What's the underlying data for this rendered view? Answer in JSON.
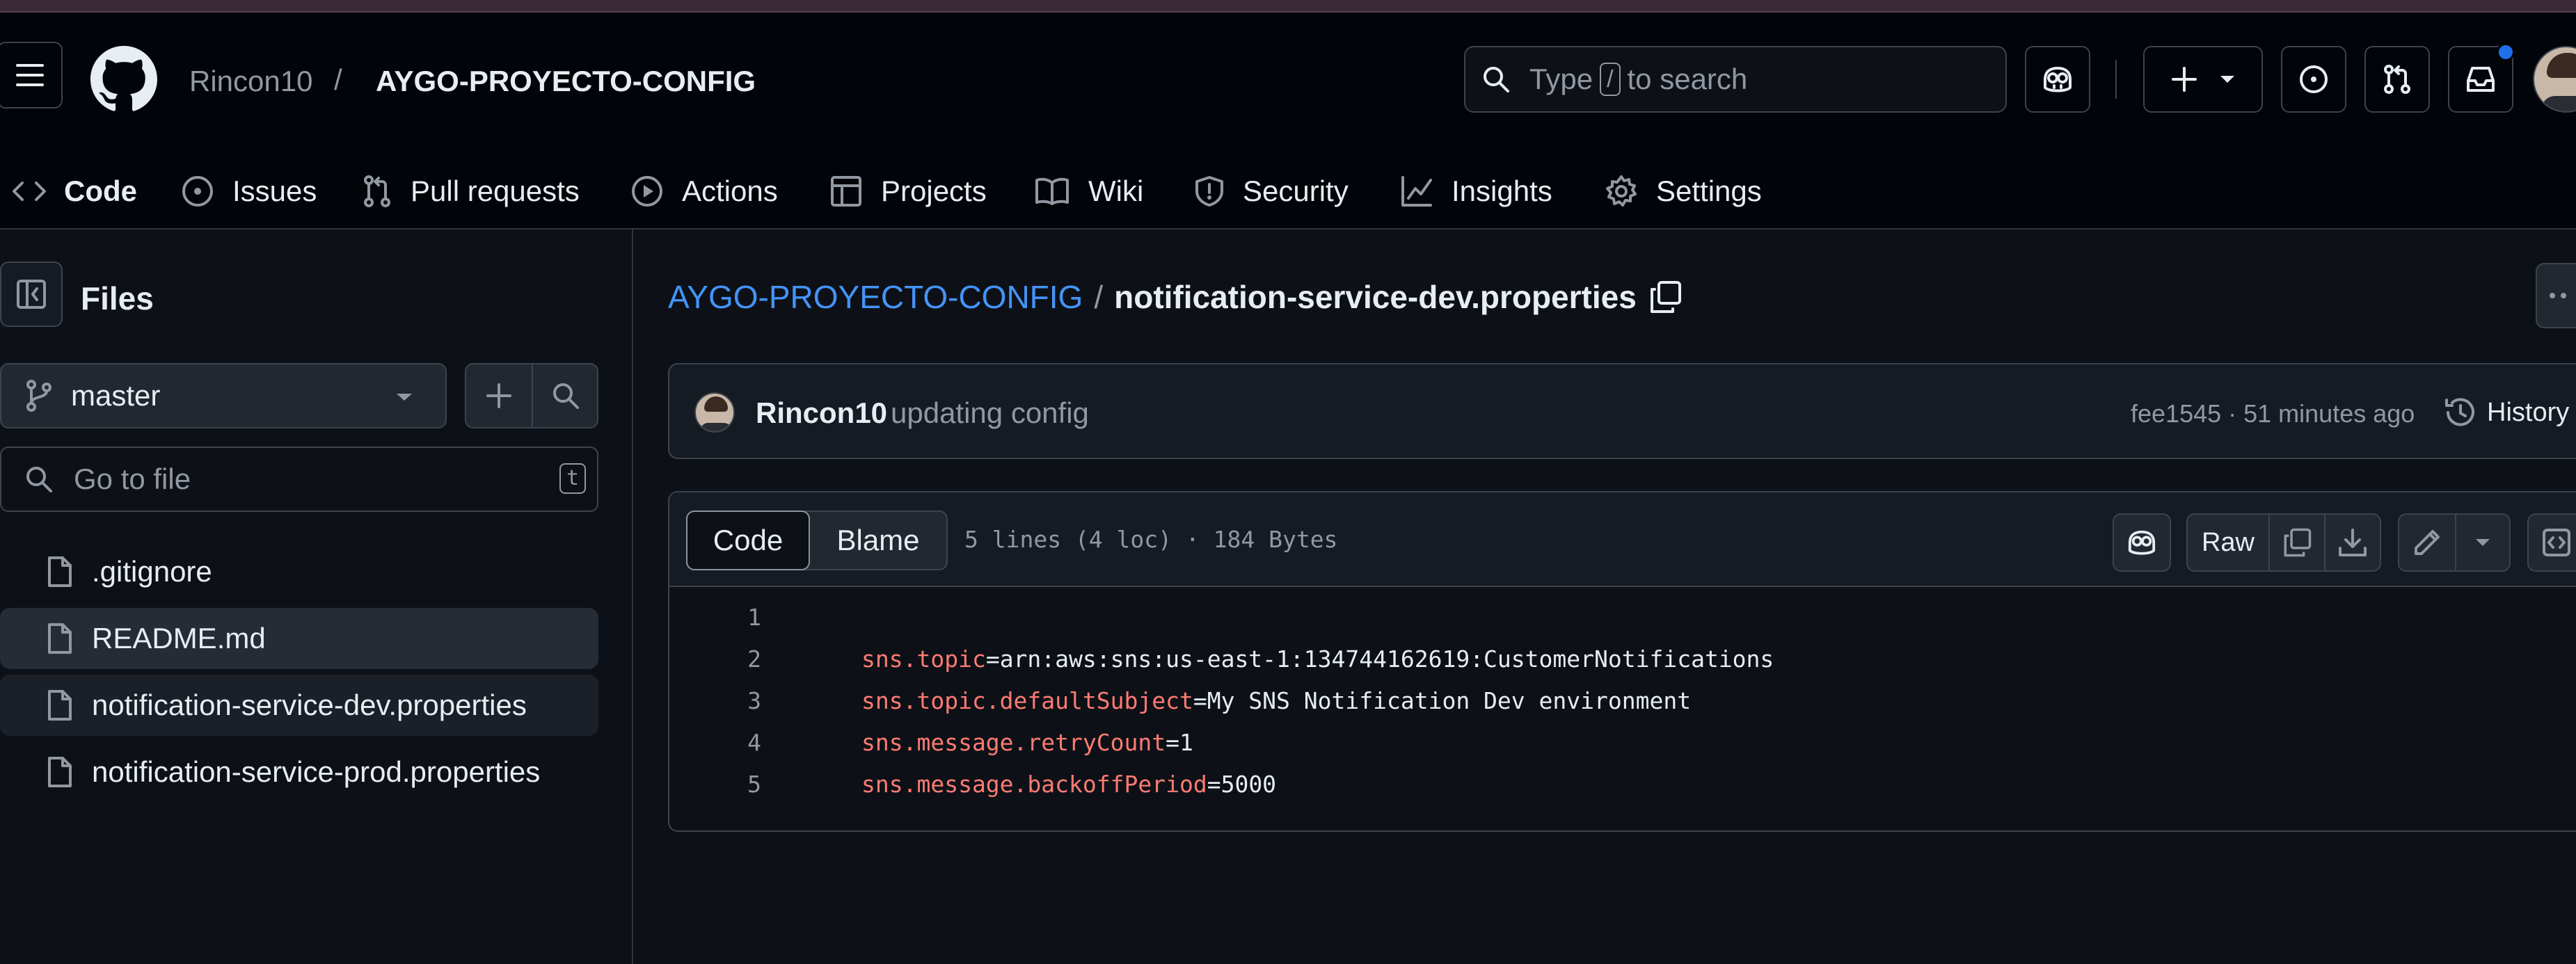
{
  "header": {
    "owner": "Rincon10",
    "separator": "/",
    "repo": "AYGO-PROYECTO-CONFIG",
    "search": {
      "prefix": "Type",
      "key": "/",
      "suffix": "to search"
    }
  },
  "tabs": [
    {
      "label": "Code",
      "icon": "code-icon",
      "selected": true
    },
    {
      "label": "Issues",
      "icon": "issue-opened-icon"
    },
    {
      "label": "Pull requests",
      "icon": "git-pull-request-icon"
    },
    {
      "label": "Actions",
      "icon": "play-icon"
    },
    {
      "label": "Projects",
      "icon": "table-icon"
    },
    {
      "label": "Wiki",
      "icon": "book-icon"
    },
    {
      "label": "Security",
      "icon": "shield-icon"
    },
    {
      "label": "Insights",
      "icon": "graph-icon"
    },
    {
      "label": "Settings",
      "icon": "gear-icon"
    }
  ],
  "sidebar": {
    "title": "Files",
    "branch": "master",
    "filter_placeholder": "Go to file",
    "filter_key": "t",
    "files": [
      {
        "name": ".gitignore"
      },
      {
        "name": "README.md",
        "hovered": true
      },
      {
        "name": "notification-service-dev.properties",
        "selected": true
      },
      {
        "name": "notification-service-prod.properties"
      }
    ]
  },
  "main": {
    "breadcrumb_repo": "AYGO-PROYECTO-CONFIG",
    "breadcrumb_sep": "/",
    "file_name": "notification-service-dev.properties",
    "commit": {
      "author": "Rincon10",
      "message": "updating config",
      "meta": "fee1545 · 51 minutes ago",
      "history_label": "History"
    },
    "view_tabs": {
      "code": "Code",
      "blame": "Blame"
    },
    "file_info": "5 lines (4 loc) · 184 Bytes",
    "raw_label": "Raw",
    "lines": [
      {
        "n": "1",
        "key": "",
        "eq": "",
        "value": ""
      },
      {
        "n": "2",
        "key": "sns.topic",
        "eq": "=",
        "value": "arn:aws:sns:us-east-1:134744162619:CustomerNotifications"
      },
      {
        "n": "3",
        "key": "sns.topic.defaultSubject",
        "eq": "=",
        "value": "My SNS Notification Dev environment"
      },
      {
        "n": "4",
        "key": "sns.message.retryCount",
        "eq": "=",
        "value": "1"
      },
      {
        "n": "5",
        "key": "sns.message.backoffPeriod",
        "eq": "=",
        "value": "5000"
      }
    ]
  },
  "colors": {
    "background": "#0d1117",
    "header": "#010409",
    "accent_link": "#4493f8",
    "tab_underline": "#f78166",
    "code_key": "#ff7b72",
    "notification_dot": "#1f6feb"
  }
}
